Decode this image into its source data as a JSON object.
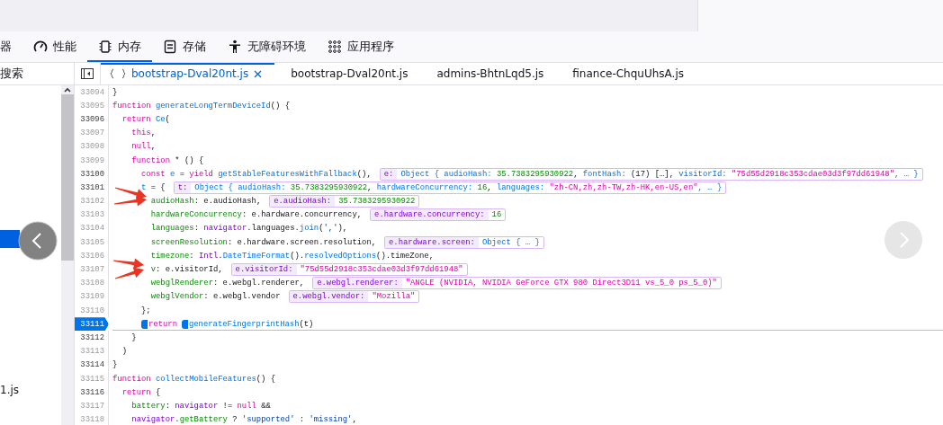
{
  "toolbar": {
    "tabs": [
      {
        "label": "器",
        "selected": false
      },
      {
        "label": "性能",
        "selected": false
      },
      {
        "label": "内存",
        "selected": true
      },
      {
        "label": "存储",
        "selected": false
      },
      {
        "label": "无障碍环境",
        "selected": false
      },
      {
        "label": "应用程序",
        "selected": false
      }
    ]
  },
  "sidebar": {
    "title": "搜索",
    "items": [
      {
        "selected": true
      },
      {
        "label": "1.js",
        "selected": false
      }
    ]
  },
  "editor_tabs": [
    {
      "label": "bootstrap-Dval20nt.js",
      "selected": true,
      "pretty": true,
      "closable": true
    },
    {
      "label": "bootstrap-Dval20nt.js",
      "selected": false,
      "pretty": false,
      "closable": false
    },
    {
      "label": "admins-BhtnLqd5.js",
      "selected": false,
      "pretty": false,
      "closable": false
    },
    {
      "label": "finance-ChquUhsA.js",
      "selected": false,
      "pretty": false,
      "closable": false
    }
  ],
  "code": {
    "lines": [
      {
        "number": "33094",
        "executable": false,
        "paused": false,
        "segments": [
          {
            "text": "}",
            "kind": "plain"
          }
        ]
      },
      {
        "number": "33095",
        "executable": false,
        "paused": false,
        "segments": [
          {
            "text": "function ",
            "kind": "kw"
          },
          {
            "text": "generateLongTermDeviceId",
            "kind": "fn"
          },
          {
            "text": "() {",
            "kind": "plain"
          }
        ]
      },
      {
        "number": "33096",
        "executable": true,
        "paused": false,
        "segments": [
          {
            "text": "  return ",
            "kind": "kw"
          },
          {
            "text": "Ce",
            "kind": "fn"
          },
          {
            "text": "(",
            "kind": "plain"
          }
        ]
      },
      {
        "number": "33097",
        "executable": false,
        "paused": false,
        "segments": [
          {
            "text": "    this",
            "kind": "kw"
          },
          {
            "text": ",",
            "kind": "plain"
          }
        ]
      },
      {
        "number": "33098",
        "executable": false,
        "paused": false,
        "segments": [
          {
            "text": "    null",
            "kind": "kw"
          },
          {
            "text": ",",
            "kind": "plain"
          }
        ]
      },
      {
        "number": "33099",
        "executable": false,
        "paused": false,
        "segments": [
          {
            "text": "    function",
            "kind": "kw"
          },
          {
            "text": " * () {",
            "kind": "plain"
          }
        ]
      },
      {
        "number": "33100",
        "executable": true,
        "paused": false,
        "segments": [
          {
            "text": "      const ",
            "kind": "kw"
          },
          {
            "text": "e",
            "kind": "fn"
          },
          {
            "text": " = ",
            "kind": "plain"
          },
          {
            "text": "yield ",
            "kind": "kw"
          },
          {
            "text": "getStableFeaturesWithFallback",
            "kind": "fn"
          },
          {
            "text": "(),",
            "kind": "plain"
          }
        ],
        "preview": {
          "label": "e:",
          "value": [
            {
              "text": "Object { ",
              "kind": "obj"
            },
            {
              "text": "audioHash: ",
              "kind": "key"
            },
            {
              "text": "35.7383295930922",
              "kind": "num"
            },
            {
              "text": ", ",
              "kind": "plain"
            },
            {
              "text": "fontHash: ",
              "kind": "key"
            },
            {
              "text": "(17) […]",
              "kind": "plain"
            },
            {
              "text": ", ",
              "kind": "plain"
            },
            {
              "text": "visitorId: ",
              "kind": "key"
            },
            {
              "text": "\"75d55d2918c353cdae03d3f97dd61948\"",
              "kind": "str"
            },
            {
              "text": ", … }",
              "kind": "obj"
            }
          ]
        }
      },
      {
        "number": "33101",
        "executable": true,
        "paused": false,
        "segments": [
          {
            "text": "      t",
            "kind": "fn"
          },
          {
            "text": " = {",
            "kind": "plain"
          }
        ],
        "preview": {
          "label": "t:",
          "value": [
            {
              "text": "Object { ",
              "kind": "obj"
            },
            {
              "text": "audioHash: ",
              "kind": "key"
            },
            {
              "text": "35.7383295930922",
              "kind": "num"
            },
            {
              "text": ", ",
              "kind": "plain"
            },
            {
              "text": "hardwareConcurrency: ",
              "kind": "key"
            },
            {
              "text": "16",
              "kind": "num"
            },
            {
              "text": ", ",
              "kind": "plain"
            },
            {
              "text": "languages: ",
              "kind": "key"
            },
            {
              "text": "\"zh-CN,zh,zh-TW,zh-HK,en-US,en\"",
              "kind": "str"
            },
            {
              "text": ", … }",
              "kind": "obj"
            }
          ]
        }
      },
      {
        "number": "33102",
        "executable": false,
        "paused": false,
        "segments": [
          {
            "text": "        audioHash",
            "kind": "prop"
          },
          {
            "text": ": e.audioHash,",
            "kind": "plain"
          }
        ],
        "preview": {
          "label": "e.audioHash:",
          "value": [
            {
              "text": "35.7383295930922",
              "kind": "num"
            }
          ]
        }
      },
      {
        "number": "33103",
        "executable": false,
        "paused": false,
        "segments": [
          {
            "text": "        hardwareConcurrency",
            "kind": "prop"
          },
          {
            "text": ": e.hardware.concurrency,",
            "kind": "plain"
          }
        ],
        "preview": {
          "label": "e.hardware.concurrency:",
          "value": [
            {
              "text": "16",
              "kind": "num"
            }
          ]
        }
      },
      {
        "number": "33104",
        "executable": false,
        "paused": false,
        "segments": [
          {
            "text": "        languages",
            "kind": "prop"
          },
          {
            "text": ": ",
            "kind": "plain"
          },
          {
            "text": "navigator",
            "kind": "var"
          },
          {
            "text": ".languages.",
            "kind": "plain"
          },
          {
            "text": "join",
            "kind": "fn"
          },
          {
            "text": "(",
            "kind": "plain"
          },
          {
            "text": "','",
            "kind": "str2"
          },
          {
            "text": "),",
            "kind": "plain"
          }
        ]
      },
      {
        "number": "33105",
        "executable": false,
        "paused": false,
        "segments": [
          {
            "text": "        screenResolution",
            "kind": "prop"
          },
          {
            "text": ": e.hardware.screen.resolution,",
            "kind": "plain"
          }
        ],
        "preview": {
          "label": "e.hardware.screen:",
          "value": [
            {
              "text": "Object { … }",
              "kind": "obj"
            }
          ]
        }
      },
      {
        "number": "33106",
        "executable": false,
        "paused": false,
        "segments": [
          {
            "text": "        timezone",
            "kind": "prop"
          },
          {
            "text": ": ",
            "kind": "plain"
          },
          {
            "text": "Intl",
            "kind": "var"
          },
          {
            "text": ".",
            "kind": "plain"
          },
          {
            "text": "DateTimeFormat",
            "kind": "fn"
          },
          {
            "text": "().",
            "kind": "plain"
          },
          {
            "text": "resolvedOptions",
            "kind": "fn"
          },
          {
            "text": "().timeZone,",
            "kind": "plain"
          }
        ]
      },
      {
        "number": "33107",
        "executable": false,
        "paused": false,
        "segments": [
          {
            "text": "        v",
            "kind": "prop"
          },
          {
            "text": ": e.visitorId,",
            "kind": "plain"
          }
        ],
        "preview": {
          "label": "e.visitorId:",
          "value": [
            {
              "text": "\"75d55d2918c353cdae03d3f97dd61948\"",
              "kind": "str"
            }
          ]
        }
      },
      {
        "number": "33108",
        "executable": false,
        "paused": false,
        "segments": [
          {
            "text": "        webglRenderer",
            "kind": "prop"
          },
          {
            "text": ": e.webgl.renderer,",
            "kind": "plain"
          }
        ],
        "preview": {
          "label": "e.webgl.renderer:",
          "value": [
            {
              "text": "\"ANGLE (NVIDIA, NVIDIA GeForce GTX 980 Direct3D11 vs_5_0 ps_5_0)\"",
              "kind": "str"
            }
          ]
        }
      },
      {
        "number": "33109",
        "executable": false,
        "paused": false,
        "segments": [
          {
            "text": "        webglVendor",
            "kind": "prop"
          },
          {
            "text": ": e.webgl.vendor",
            "kind": "plain"
          }
        ],
        "preview": {
          "label": "e.webgl.vendor:",
          "value": [
            {
              "text": "\"Mozilla\"",
              "kind": "str"
            }
          ]
        }
      },
      {
        "number": "33110",
        "executable": false,
        "paused": false,
        "segments": [
          {
            "text": "      };",
            "kind": "plain"
          }
        ]
      },
      {
        "number": "33111",
        "executable": true,
        "paused": true,
        "segments": [
          {
            "text": "return",
            "kind": "kw",
            "marker": true
          },
          {
            "text": "generateFingerprintHash",
            "kind": "fn",
            "marker": true
          },
          {
            "text": "(t)",
            "kind": "plain"
          }
        ]
      },
      {
        "number": "33112",
        "executable": true,
        "paused": false,
        "segments": [
          {
            "text": "    }",
            "kind": "plain"
          }
        ]
      },
      {
        "number": "33113",
        "executable": false,
        "paused": false,
        "segments": [
          {
            "text": "  )",
            "kind": "plain"
          }
        ]
      },
      {
        "number": "33114",
        "executable": true,
        "paused": false,
        "segments": [
          {
            "text": "}",
            "kind": "plain"
          }
        ]
      },
      {
        "number": "33115",
        "executable": false,
        "paused": false,
        "segments": [
          {
            "text": "function ",
            "kind": "kw"
          },
          {
            "text": "collectMobileFeatures",
            "kind": "fn"
          },
          {
            "text": "() {",
            "kind": "plain"
          }
        ]
      },
      {
        "number": "33116",
        "executable": true,
        "paused": false,
        "segments": [
          {
            "text": "  return",
            "kind": "kw"
          },
          {
            "text": " {",
            "kind": "plain"
          }
        ]
      },
      {
        "number": "33117",
        "executable": false,
        "paused": false,
        "segments": [
          {
            "text": "    battery",
            "kind": "prop"
          },
          {
            "text": ": ",
            "kind": "plain"
          },
          {
            "text": "navigator",
            "kind": "var"
          },
          {
            "text": " != ",
            "kind": "plain"
          },
          {
            "text": "null",
            "kind": "kw"
          },
          {
            "text": " &&",
            "kind": "plain"
          }
        ]
      },
      {
        "number": "33118",
        "executable": false,
        "paused": false,
        "segments": [
          {
            "text": "    navigator",
            "kind": "var"
          },
          {
            "text": ".",
            "kind": "plain"
          },
          {
            "text": "getBattery",
            "kind": "prop"
          },
          {
            "text": " ? ",
            "kind": "plain"
          },
          {
            "text": "'supported'",
            "kind": "str2"
          },
          {
            "text": " : ",
            "kind": "plain"
          },
          {
            "text": "'missing'",
            "kind": "str2"
          },
          {
            "text": ",",
            "kind": "plain"
          }
        ]
      }
    ]
  }
}
